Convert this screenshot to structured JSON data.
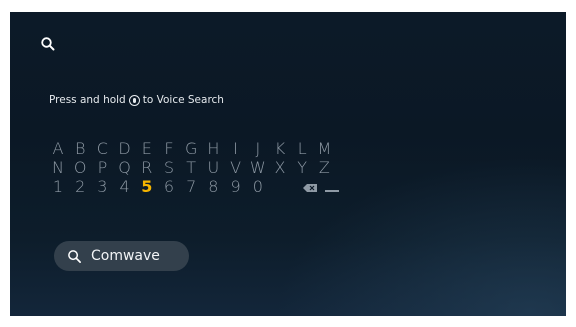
{
  "header": {
    "search_icon": "search-icon"
  },
  "hint": {
    "prefix": "Press and hold",
    "icon": "mic-icon",
    "suffix": "to Voice Search"
  },
  "keyboard": {
    "rows": [
      [
        "A",
        "B",
        "C",
        "D",
        "E",
        "F",
        "G",
        "H",
        "I",
        "J",
        "K",
        "L",
        "M"
      ],
      [
        "N",
        "O",
        "P",
        "Q",
        "R",
        "S",
        "T",
        "U",
        "V",
        "W",
        "X",
        "Y",
        "Z"
      ],
      [
        "1",
        "2",
        "3",
        "4",
        "5",
        "6",
        "7",
        "8",
        "9",
        "0"
      ]
    ],
    "selected_key": "5",
    "special_keys": [
      "delete-icon",
      "space-icon"
    ]
  },
  "query": {
    "icon": "search-icon",
    "text": "Comwave"
  },
  "colors": {
    "background": "#0c1a28",
    "key_text": "#8f9aa5",
    "key_selected": "#f4b400",
    "pill": "#33404c"
  }
}
